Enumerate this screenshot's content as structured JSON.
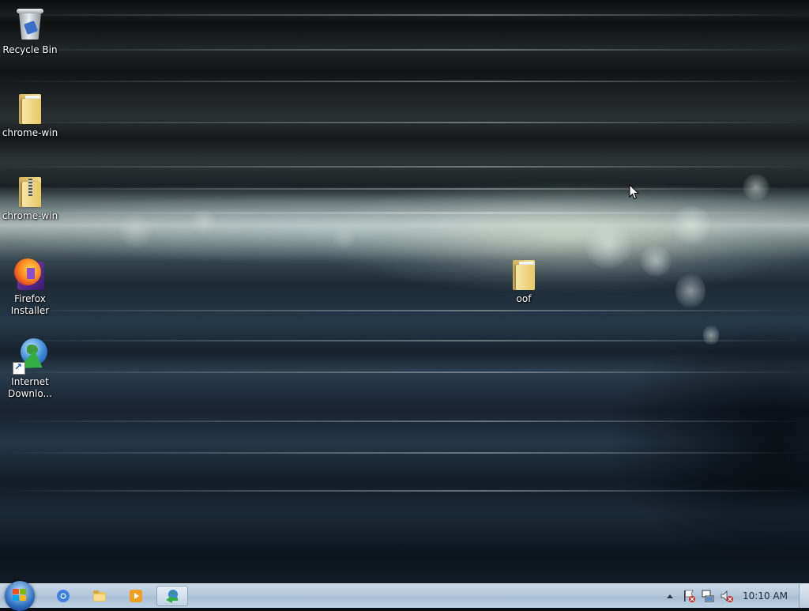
{
  "desktop": {
    "icons": [
      {
        "label": "Recycle Bin",
        "icon": "recycle-bin-icon"
      },
      {
        "label": "chrome-win",
        "icon": "folder-icon"
      },
      {
        "label": "chrome-win",
        "icon": "zip-folder-icon"
      },
      {
        "label": "Firefox\nInstaller",
        "icon": "firefox-installer-icon"
      },
      {
        "label": "Internet\nDownlo...",
        "icon": "internet-download-manager-icon"
      },
      {
        "label": "oof",
        "icon": "folder-icon"
      }
    ]
  },
  "taskbar": {
    "pinned": [
      {
        "name": "chrome",
        "icon": "chrome-icon"
      },
      {
        "name": "explorer",
        "icon": "file-explorer-icon"
      },
      {
        "name": "media-player",
        "icon": "media-player-icon"
      },
      {
        "name": "idm",
        "icon": "internet-download-manager-icon",
        "active": true
      }
    ],
    "tray": {
      "icons": [
        "show-hidden-icons-arrow",
        "action-center-flag-icon",
        "network-icon",
        "volume-muted-icon"
      ],
      "clock": "10:10 AM"
    }
  }
}
